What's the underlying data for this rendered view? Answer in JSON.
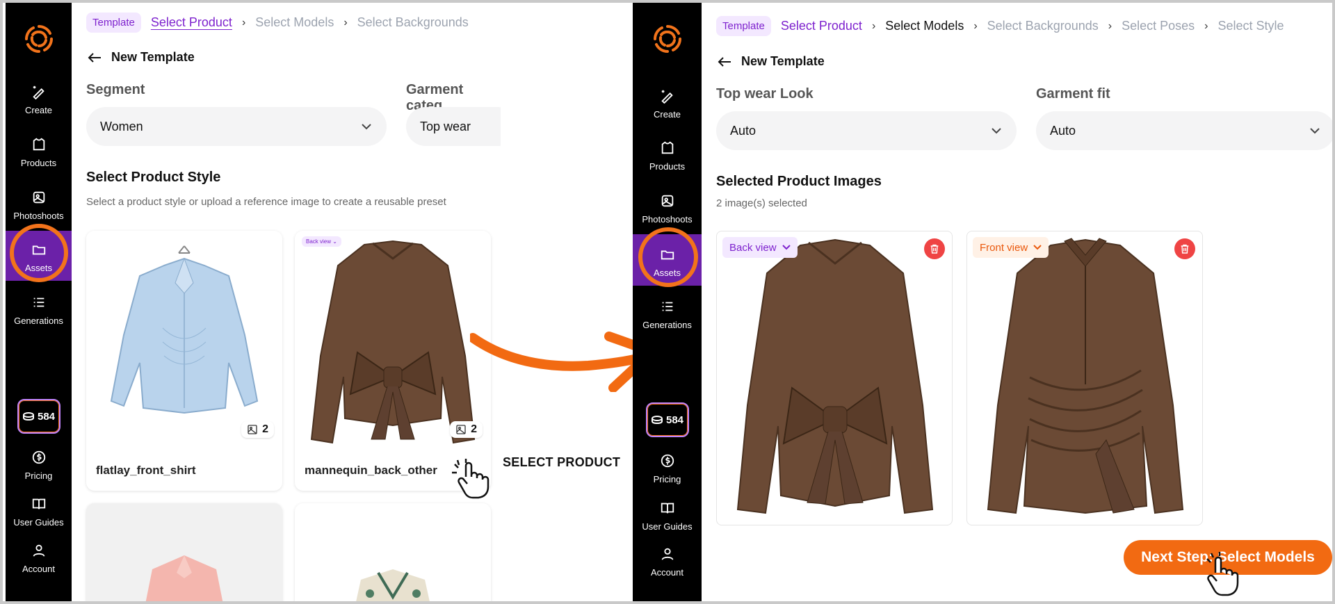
{
  "brand_color": "#f2731b",
  "accent_color": "#7e22ce",
  "sidebar": {
    "items": [
      {
        "label": "Create",
        "icon": "sparkle-pencil-icon"
      },
      {
        "label": "Products",
        "icon": "shirt-icon"
      },
      {
        "label": "Photoshoots",
        "icon": "image-icon"
      },
      {
        "label": "Assets",
        "icon": "folder-icon"
      },
      {
        "label": "Generations",
        "icon": "list-icon"
      }
    ],
    "credits": "584",
    "bottom_items": [
      {
        "label": "Pricing",
        "icon": "dollar-icon"
      },
      {
        "label": "User Guides",
        "icon": "book-icon"
      },
      {
        "label": "Account",
        "icon": "user-icon"
      }
    ]
  },
  "left": {
    "breadcrumbs": {
      "template": "Template",
      "current": "Select Product",
      "next1": "Select Models",
      "next2": "Select Backgrounds"
    },
    "back_label": "New Template",
    "segment_label": "Segment",
    "segment_value": "Women",
    "category_label": "Garment categ",
    "category_value": "Top wear",
    "section_title": "Select Product Style",
    "section_subtitle": "Select a product style or upload a reference image to create a reusable preset",
    "cards": [
      {
        "name": "flatlay_front_shirt",
        "count": "2"
      },
      {
        "name": "mannequin_back_other",
        "count": "2",
        "badge": "Back view"
      }
    ]
  },
  "annotation": "SELECT PRODUCT",
  "right": {
    "breadcrumbs": {
      "template": "Template",
      "current": "Select Product",
      "done": "Select Models",
      "next1": "Select Backgrounds",
      "next2": "Select Poses",
      "next3": "Select Style"
    },
    "back_label": "New Template",
    "look_label": "Top wear Look",
    "look_value": "Auto",
    "fit_label": "Garment fit",
    "fit_value": "Auto",
    "section_title": "Selected Product Images",
    "selected_count": "2 image(s) selected",
    "images": [
      {
        "badge": "Back view",
        "badge_color": "#7e22ce"
      },
      {
        "badge": "Front view",
        "badge_color": "#ea580c"
      }
    ],
    "next_button": "Next Step: Select Models"
  }
}
